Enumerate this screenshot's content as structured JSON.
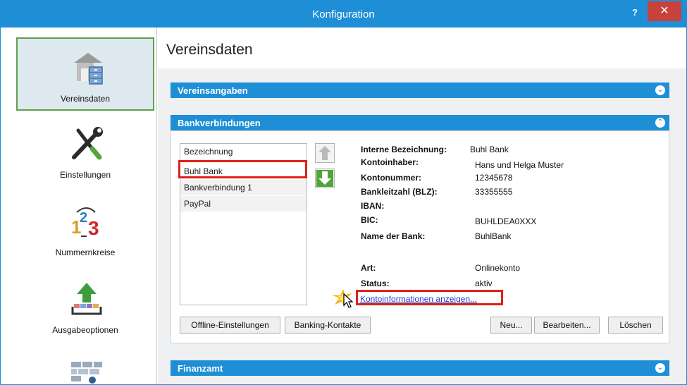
{
  "window": {
    "title": "Konfiguration",
    "help_label": "?",
    "close_label": "✕"
  },
  "sidebar": {
    "items": [
      {
        "label": "Vereinsdaten",
        "icon": "club-data-icon"
      },
      {
        "label": "Einstellungen",
        "icon": "tools-icon"
      },
      {
        "label": "Nummernkreise",
        "icon": "number-ranges-icon"
      },
      {
        "label": "Ausgabeoptionen",
        "icon": "output-options-icon"
      },
      {
        "label": "",
        "icon": "wall-user-icon"
      }
    ]
  },
  "main": {
    "title": "Vereinsdaten",
    "panels": {
      "vereinsangaben": "Vereinsangaben",
      "bankverbindungen": "Bankverbindungen",
      "finanzamt": "Finanzamt"
    },
    "bank_list": {
      "header": "Bezeichnung",
      "items": [
        "Buhl Bank",
        "Bankverbindung 1",
        "PayPal"
      ]
    },
    "details": {
      "interne_label": "Interne Bezeichnung:",
      "interne_value": "Buhl Bank",
      "inhaber_label": "Kontoinhaber:",
      "inhaber_value": "Hans und Helga Muster",
      "nummer_label": "Kontonummer:",
      "nummer_value": "12345678",
      "blz_label": "Bankleitzahl (BLZ):",
      "blz_value": "33355555",
      "iban_label": "IBAN:",
      "iban_value": "",
      "bic_label": "BIC:",
      "bic_value": "BUHLDEA0XXX",
      "bankname_label": "Name der Bank:",
      "bankname_value": "BuhlBank",
      "art_label": "Art:",
      "art_value": "Onlinekonto",
      "status_label": "Status:",
      "status_value": "aktiv",
      "link": "Kontoinformationen anzeigen..."
    },
    "buttons": {
      "offline": "Offline-Einstellungen",
      "banking": "Banking-Kontakte",
      "neu": "Neu...",
      "bearbeiten": "Bearbeiten...",
      "loeschen": "Löschen"
    }
  },
  "colors": {
    "accent": "#1e8fd6",
    "highlight": "#e1201a",
    "active_border": "#5da24a"
  }
}
